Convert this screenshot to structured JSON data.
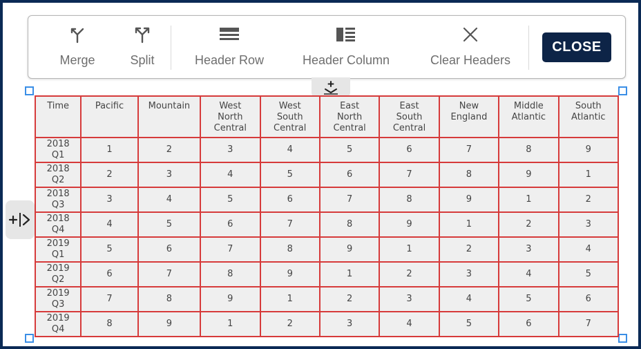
{
  "toolbar": {
    "merge_label": "Merge",
    "split_label": "Split",
    "header_row_label": "Header Row",
    "header_column_label": "Header Column",
    "clear_headers_label": "Clear Headers",
    "close_label": "CLOSE"
  },
  "colors": {
    "close_button": "#0d2447",
    "cell_border": "#d63a3a",
    "cell_background": "#efefef",
    "handle": "#3a8ee6"
  },
  "table": {
    "headers": [
      "Time",
      "Pacific",
      "Mountain",
      "West\nNorth\nCentral",
      "West\nSouth\nCentral",
      "East\nNorth\nCentral",
      "East\nSouth\nCentral",
      "New\nEngland",
      "Middle\nAtlantic",
      "South\nAtlantic"
    ],
    "rows": [
      [
        "2018\nQ1",
        "1",
        "2",
        "3",
        "4",
        "5",
        "6",
        "7",
        "8",
        "9"
      ],
      [
        "2018\nQ2",
        "2",
        "3",
        "4",
        "5",
        "6",
        "7",
        "8",
        "9",
        "1"
      ],
      [
        "2018\nQ3",
        "3",
        "4",
        "5",
        "6",
        "7",
        "8",
        "9",
        "1",
        "2"
      ],
      [
        "2018\nQ4",
        "4",
        "5",
        "6",
        "7",
        "8",
        "9",
        "1",
        "2",
        "3"
      ],
      [
        "2019\nQ1",
        "5",
        "6",
        "7",
        "8",
        "9",
        "1",
        "2",
        "3",
        "4"
      ],
      [
        "2019\nQ2",
        "6",
        "7",
        "8",
        "9",
        "1",
        "2",
        "3",
        "4",
        "5"
      ],
      [
        "2019\nQ3",
        "7",
        "8",
        "9",
        "1",
        "2",
        "3",
        "4",
        "5",
        "6"
      ],
      [
        "2019\nQ4",
        "8",
        "9",
        "1",
        "2",
        "3",
        "4",
        "5",
        "6",
        "7"
      ]
    ]
  }
}
